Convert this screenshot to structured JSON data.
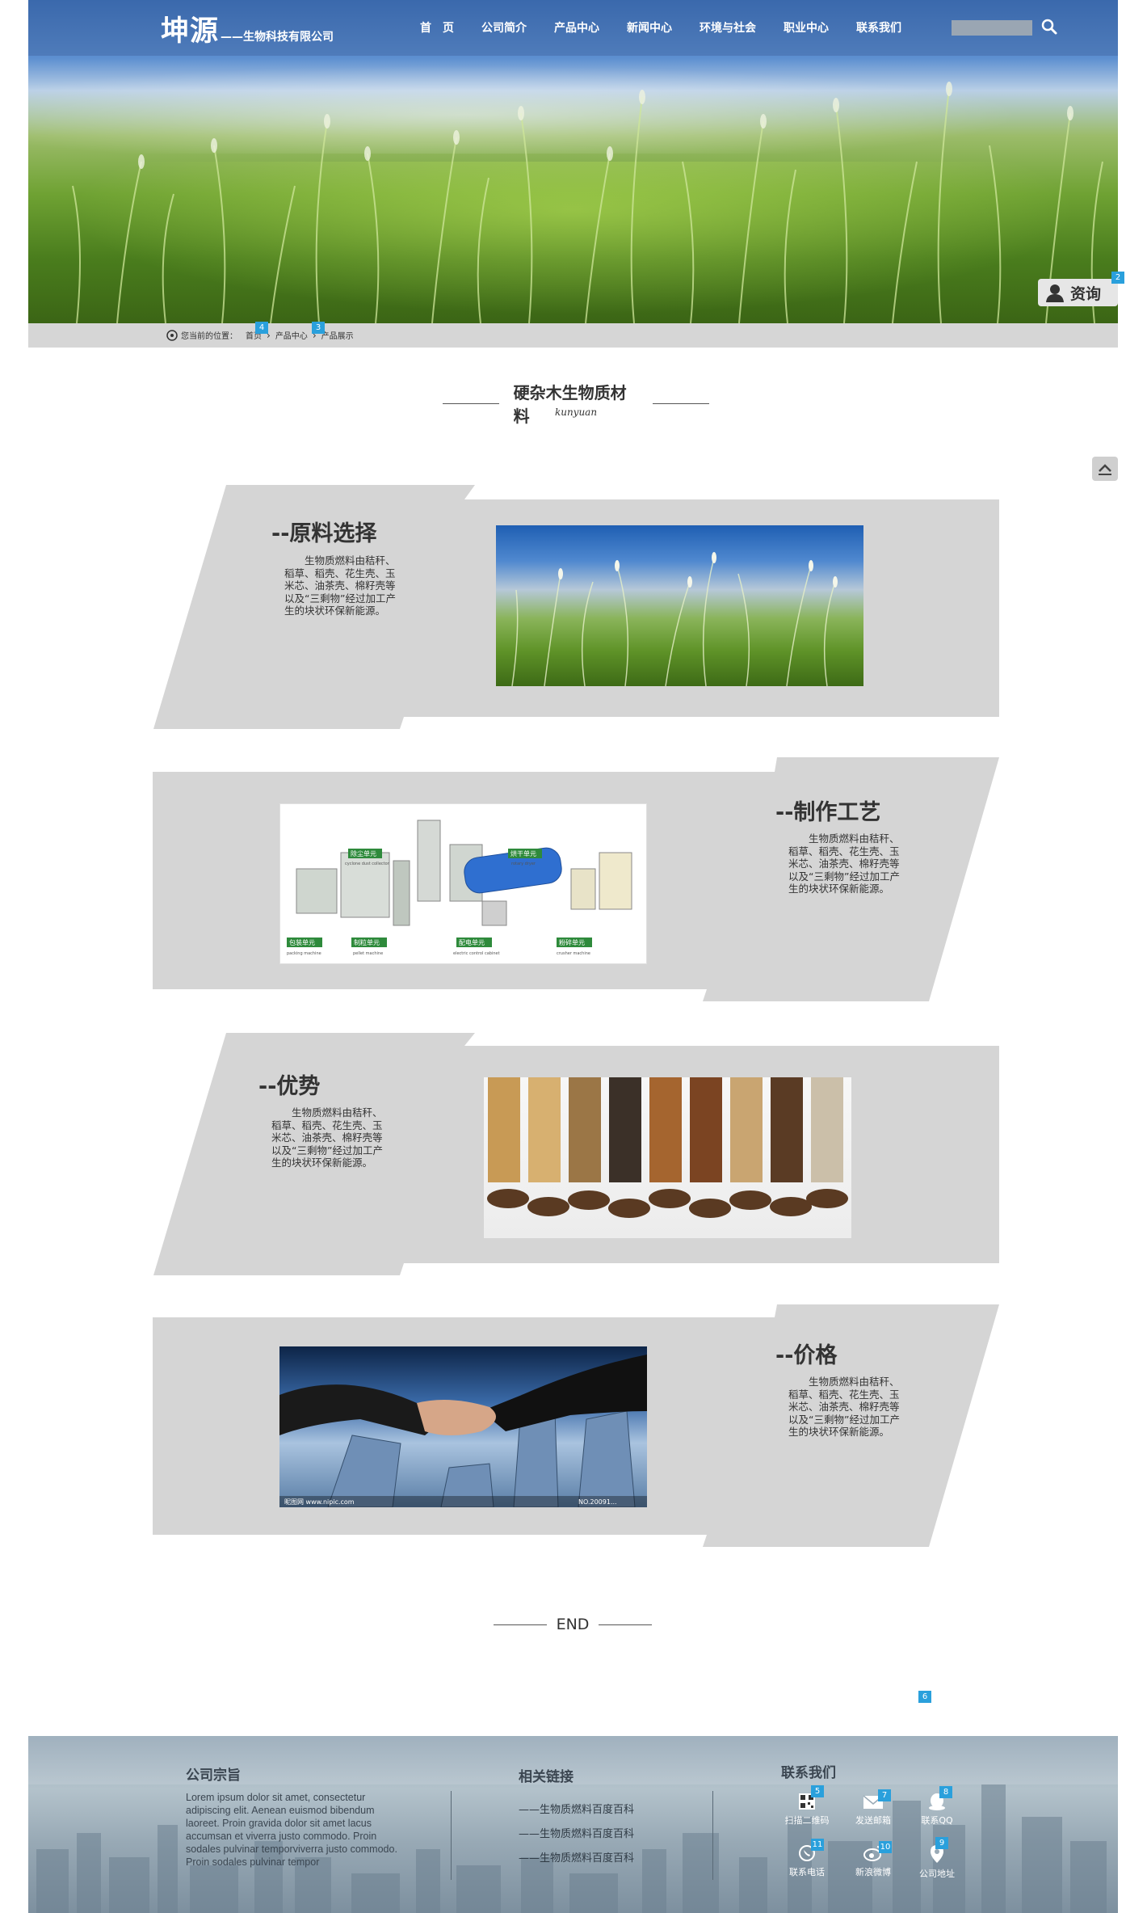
{
  "header": {
    "logo_main": "坤源",
    "logo_sub": "——生物科技有限公司",
    "nav": [
      "首　页",
      "公司简介",
      "产品中心",
      "新闻中心",
      "环境与社会",
      "职业中心",
      "联系我们"
    ],
    "search_placeholder": ""
  },
  "consult": {
    "label": "资询",
    "badge": "2"
  },
  "breadcrumb": {
    "prefix": "您当前的位置：",
    "items": [
      "首页",
      "产品中心",
      "产品展示"
    ],
    "badges": [
      "4",
      "3"
    ]
  },
  "section": {
    "title": "硬杂木生物质材料",
    "subtitle": "kunyuan"
  },
  "blocks": [
    {
      "heading": "--原料选择",
      "text": "生物质燃料由秸秆、稻草、稻壳、花生壳、玉米芯、油茶壳、棉籽壳等以及“三剩物”经过加工产生的块状环保新能源。"
    },
    {
      "heading": "--制作工艺",
      "text": "生物质燃料由秸秆、稻草、稻壳、花生壳、玉米芯、油茶壳、棉籽壳等以及“三剩物”经过加工产生的块状环保新能源。"
    },
    {
      "heading": "--优势",
      "text": "生物质燃料由秸秆、稻草、稻壳、花生壳、玉米芯、油茶壳、棉籽壳等以及“三剩物”经过加工产生的块状环保新能源。"
    },
    {
      "heading": "--价格",
      "text": "生物质燃料由秸秆、稻草、稻壳、花生壳、玉米芯、油茶壳、棉籽壳等以及“三剩物”经过加工产生的块状环保新能源。"
    }
  ],
  "machine_labels": {
    "top": [
      "除尘单元",
      "烘干单元"
    ],
    "top_en": [
      "cyclone dust collector",
      "rotary dryer"
    ],
    "bottom": [
      "包装单元",
      "制粒单元",
      "配电单元",
      "粉碎单元"
    ],
    "bottom_en": [
      "packing machine",
      "pellet machine",
      "electric control cabinet",
      "crusher machine"
    ]
  },
  "hands_watermark": {
    "left": "昵图网 www.nipic.com",
    "right": "NO.20091..."
  },
  "end": {
    "label": "END",
    "badge": "6"
  },
  "footer": {
    "about_title": "公司宗旨",
    "about_text": "Lorem ipsum dolor sit amet, consectetur adipiscing elit. Aenean euismod bibendum laoreet. Proin gravida dolor sit amet lacus accumsan et viverra justo commodo. Proin sodales pulvinar temporviverra justo commodo. Proin sodales pulvinar tempor",
    "links_title": "相关链接",
    "links": [
      "——生物质燃料百度百科",
      "——生物质燃料百度百科",
      "——生物质燃料百度百科"
    ],
    "contact_title": "联系我们",
    "contacts": [
      {
        "label": "扫描二维码",
        "icon": "qrcode-icon",
        "badge": "5"
      },
      {
        "label": "发送邮箱",
        "icon": "mail-icon",
        "badge": "7"
      },
      {
        "label": "联系QQ",
        "icon": "qq-icon",
        "badge": "8"
      },
      {
        "label": "联系电话",
        "icon": "phone-icon",
        "badge": "11"
      },
      {
        "label": "新浪微博",
        "icon": "weibo-icon",
        "badge": "10"
      },
      {
        "label": "公司地址",
        "icon": "location-icon",
        "badge": "9"
      }
    ]
  },
  "colors": {
    "badge": "#2aa0dc",
    "panel_gray": "#d5d5d5",
    "topbar": "#466eaa"
  }
}
